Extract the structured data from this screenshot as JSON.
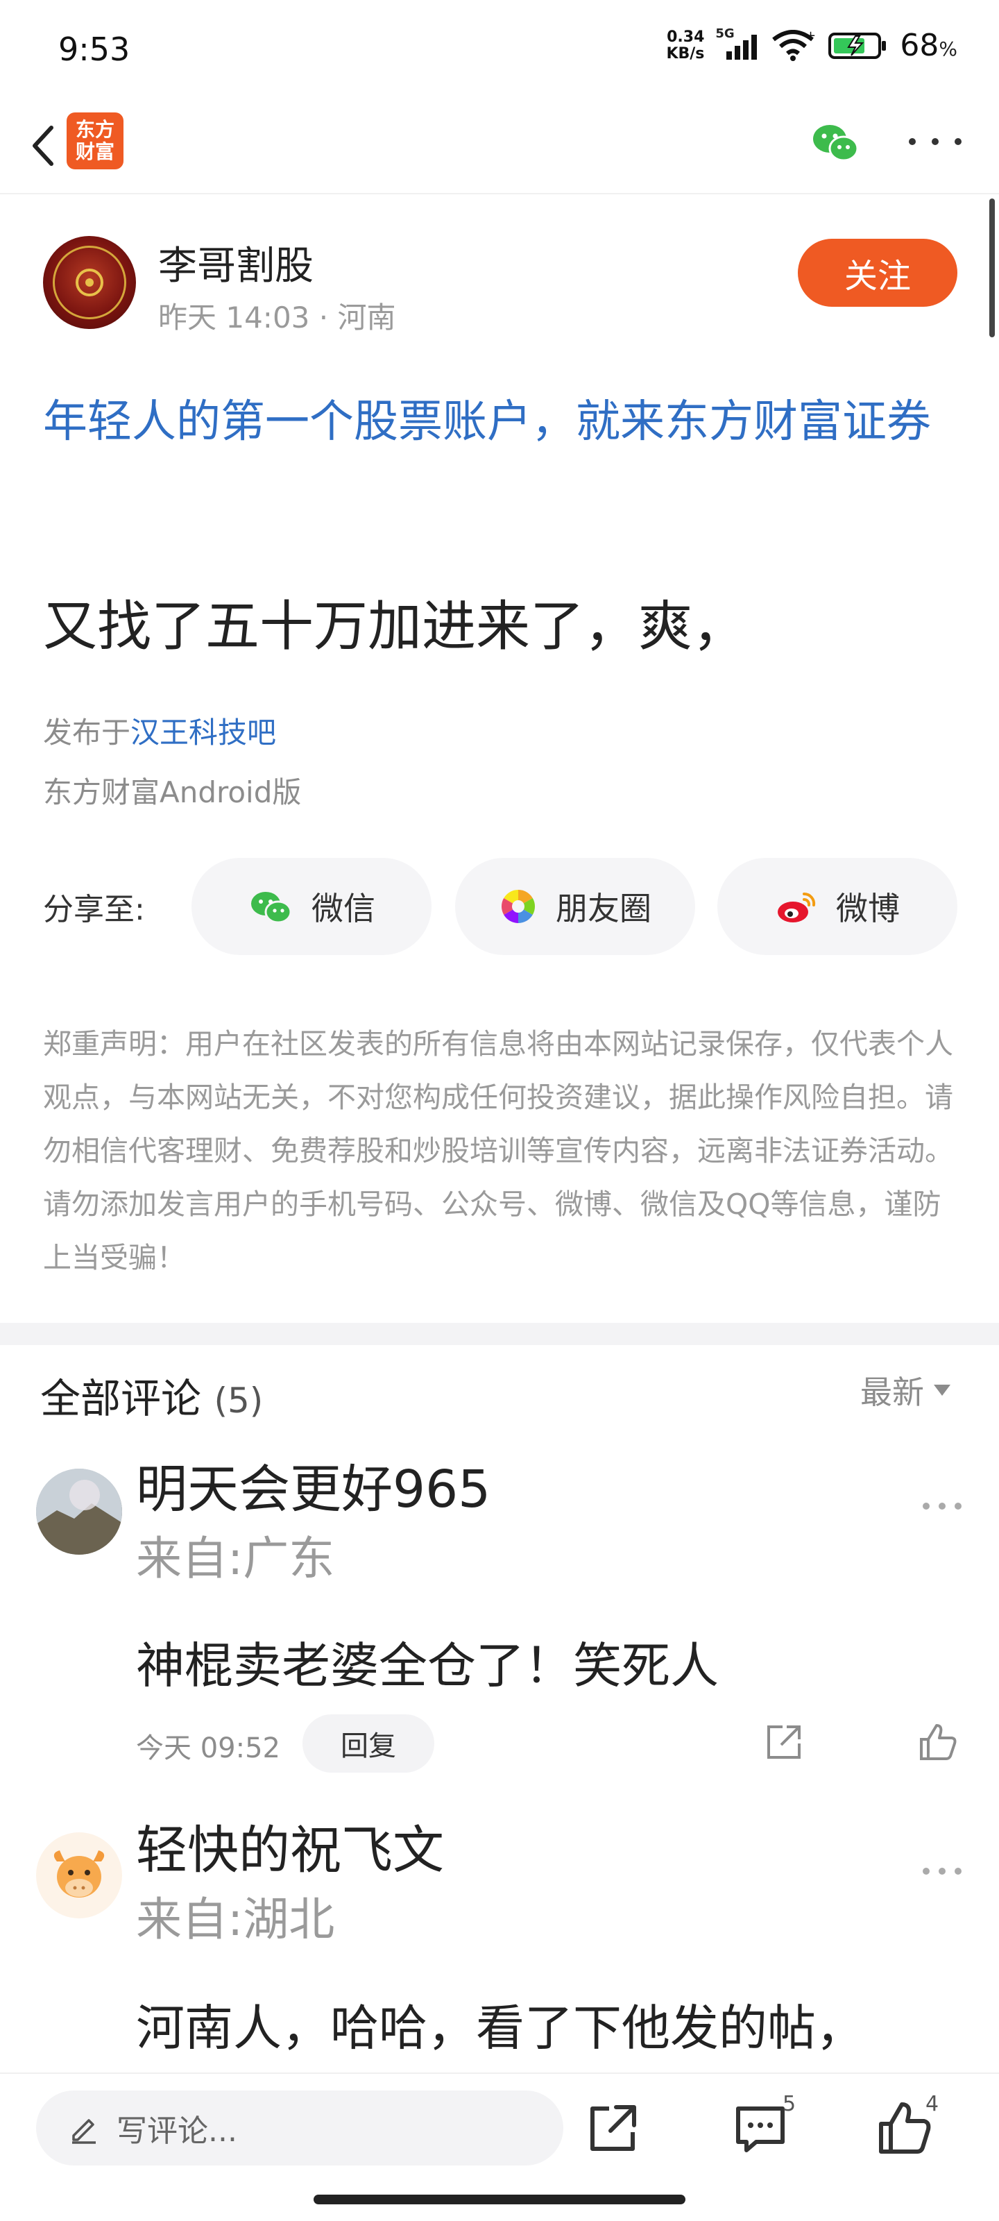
{
  "status_bar": {
    "time": "9:53",
    "net_speed_value": "0.34",
    "net_speed_unit": "KB/s",
    "network": "5G",
    "battery": "68",
    "battery_unit": "%"
  },
  "nav": {
    "app_logo_line1": "东方",
    "app_logo_line2": "财富"
  },
  "post": {
    "author": "李哥割股",
    "meta": "昨天 14:03 · 河南",
    "follow_label": "关注",
    "promo_text": "年轻人的第一个股票账户，就来东方财富证券",
    "body": "又找了五十万加进来了，爽，",
    "published_prefix": "发布于",
    "forum": "汉王科技吧",
    "platform": "东方财富Android版"
  },
  "share": {
    "label": "分享至:",
    "wechat": "微信",
    "moments": "朋友圈",
    "weibo": "微博"
  },
  "disclaimer": "郑重声明：用户在社区发表的所有信息将由本网站记录保存，仅代表个人观点，与本网站无关，不对您构成任何投资建议，据此操作风险自担。请勿相信代客理财、免费荐股和炒股培训等宣传内容，远离非法证券活动。请勿添加发言用户的手机号码、公众号、微博、微信及QQ等信息，谨防上当受骗！",
  "comments_header": {
    "title": "全部评论",
    "count": "(5)",
    "sort": "最新"
  },
  "comments": [
    {
      "name": "明天会更好965",
      "location": "来自:广东",
      "text": "神棍卖老婆全仓了！笑死人",
      "time": "今天 09:52",
      "reply_label": "回复"
    },
    {
      "name": "轻快的祝飞文",
      "location": "来自:湖北",
      "text": "河南人，哈哈，看了下他发的帖，"
    }
  ],
  "bottom_bar": {
    "write_placeholder": "写评论...",
    "comment_count": "5",
    "like_count": "4"
  },
  "colors": {
    "brand_orange": "#ef5a23",
    "link_blue": "#2f6ec4",
    "wechat_green": "#3dbb4c"
  }
}
